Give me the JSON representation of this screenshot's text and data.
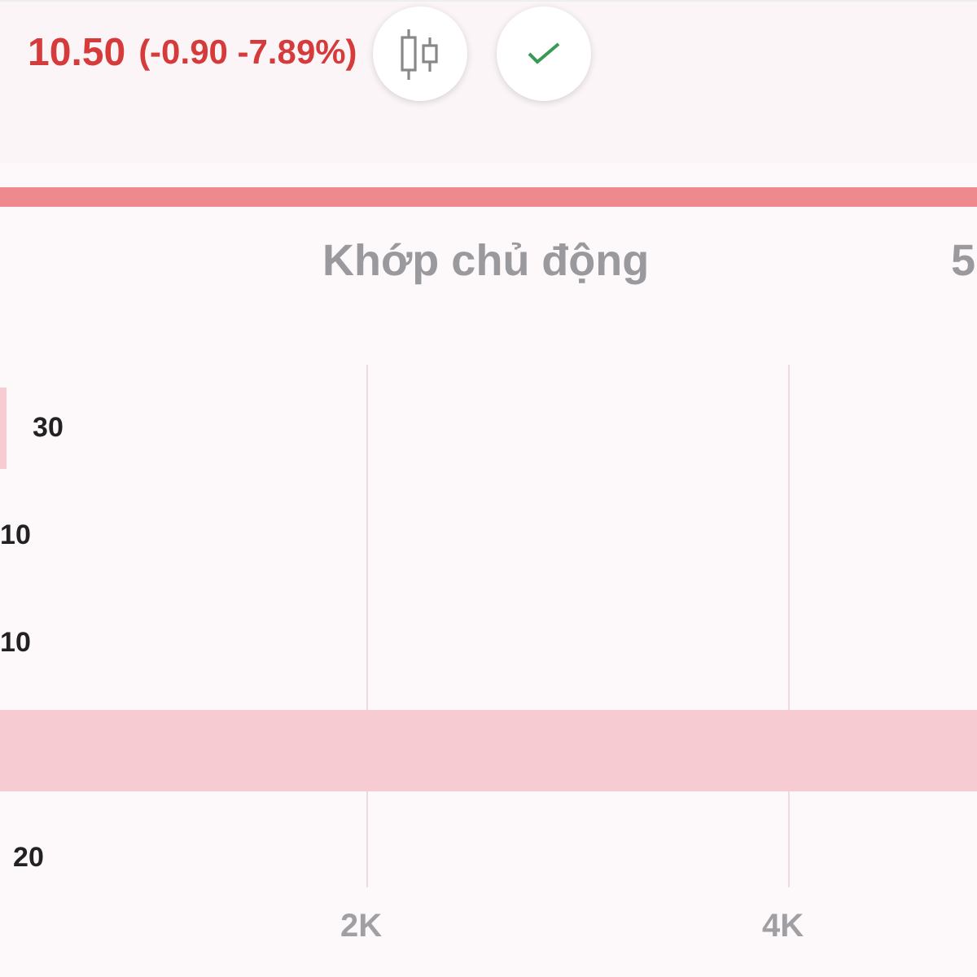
{
  "header": {
    "price": "10.50",
    "change": "(-0.90 -7.89%)",
    "buttons": [
      {
        "kind": "candles"
      },
      {
        "kind": "check"
      }
    ]
  },
  "tabs": [
    {
      "label": "Khớp chủ động",
      "selected": false
    },
    {
      "label": "5",
      "selected": false
    }
  ],
  "rows": [
    {
      "value": "30",
      "kind": "stub"
    },
    {
      "value": "10",
      "kind": "plain"
    },
    {
      "value": "10",
      "kind": "plain"
    },
    {
      "kind": "full"
    },
    {
      "value": "20",
      "kind": "plain"
    }
  ],
  "axis_ticks": [
    "2K",
    "4K"
  ]
}
